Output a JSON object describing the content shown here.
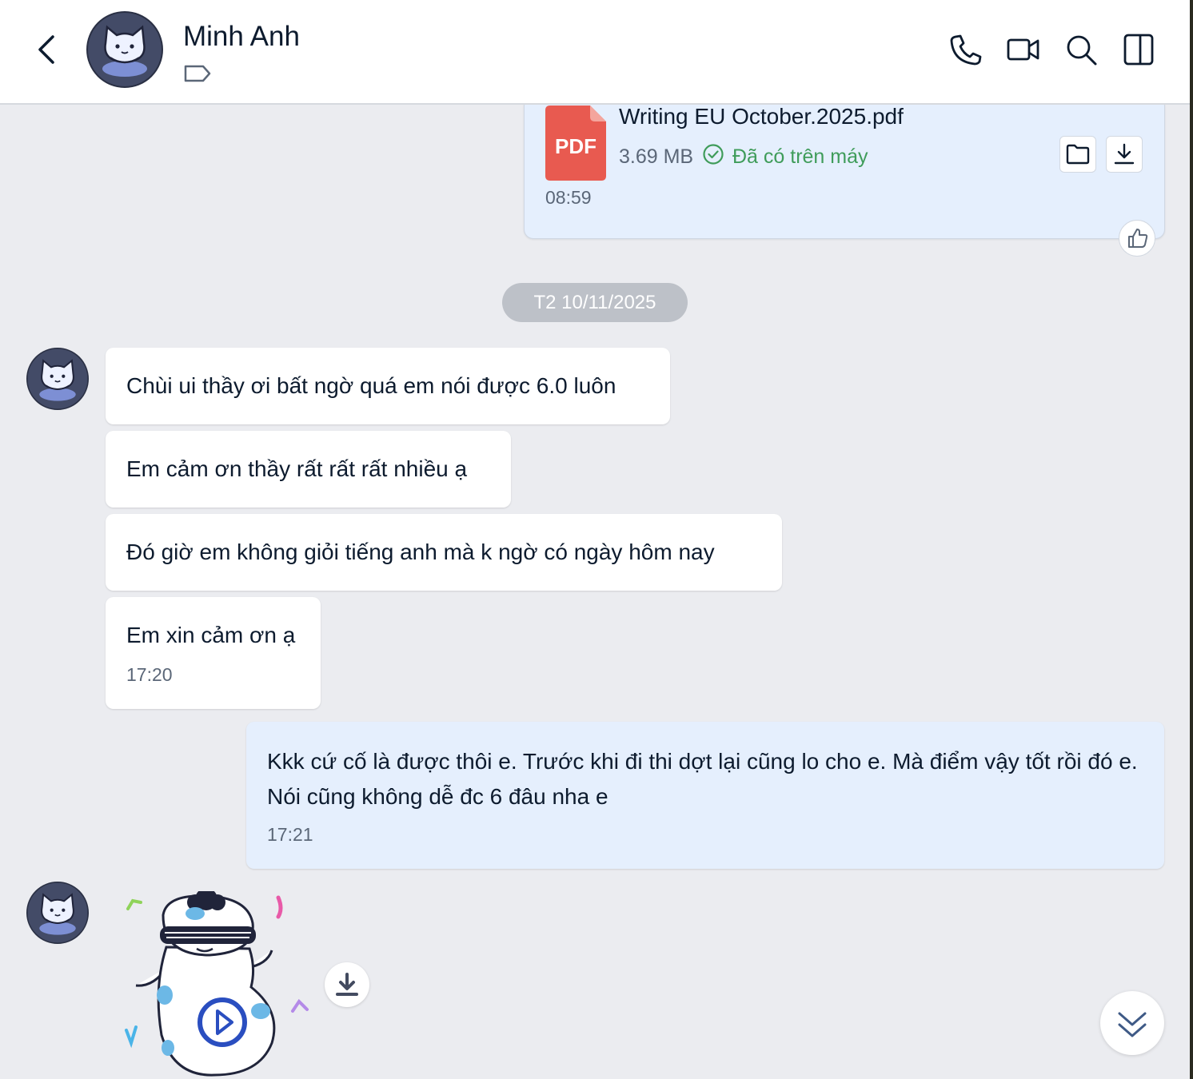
{
  "header": {
    "contact_name": "Minh Anh",
    "icons": [
      "back-icon",
      "label-tag-icon",
      "phone-call-icon",
      "video-call-icon",
      "search-icon",
      "side-panel-icon"
    ]
  },
  "file_message": {
    "badge": "PDF",
    "file_name": "Writing EU October.2025.pdf",
    "file_size": "3.69 MB",
    "status": "Đã có trên máy",
    "time": "08:59"
  },
  "date_divider": "T2 10/11/2025",
  "incoming_messages": [
    {
      "text": "Chùi ui thầy ơi bất ngờ quá em nói được 6.0 luôn"
    },
    {
      "text": "Em cảm ơn thầy rất rất rất nhiều ạ"
    },
    {
      "text": "Đó giờ em không giỏi tiếng anh mà k ngờ có ngày hôm nay"
    },
    {
      "text": "Em xin cảm ơn ạ",
      "time": "17:20"
    }
  ],
  "outgoing_message": {
    "text": "Kkk cứ cố là được thôi e. Trước khi đi thi dợt lại cũng lo cho e. Mà điểm vậy tốt rồi đó e. Nói cũng không dễ đc 6 đâu nha e",
    "time": "17:21"
  },
  "colors": {
    "outgoing_bubble": "#e5effd",
    "incoming_bubble": "#ffffff",
    "chat_background": "#ebecf0",
    "pdf_red": "#e85a50",
    "status_green": "#3f9c5a"
  }
}
